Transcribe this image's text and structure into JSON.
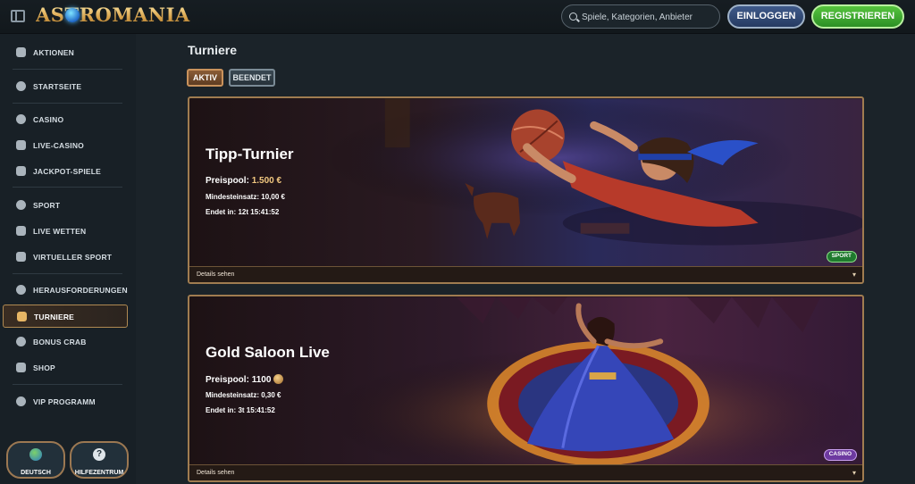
{
  "header": {
    "logo_text": "ASTROMANIA",
    "search_placeholder": "Spiele, Kategorien, Anbieter",
    "login_label": "EINLOGGEN",
    "register_label": "REGISTRIEREN"
  },
  "sidebar": {
    "items": [
      {
        "label": "AKTIONEN",
        "icon": "gift-icon"
      },
      {
        "label": "STARTSEITE",
        "icon": "globe-icon"
      },
      {
        "label": "CASINO",
        "icon": "casino-chip-icon"
      },
      {
        "label": "LIVE-CASINO",
        "icon": "cards-icon"
      },
      {
        "label": "JACKPOT-SPIELE",
        "icon": "clover-icon"
      },
      {
        "label": "SPORT",
        "icon": "soccer-ball-icon"
      },
      {
        "label": "LIVE WETTEN",
        "icon": "live-icon"
      },
      {
        "label": "VIRTUELLER SPORT",
        "icon": "monitor-icon"
      },
      {
        "label": "HERAUSFORDERUNGEN",
        "icon": "target-icon"
      },
      {
        "label": "TURNIERE",
        "icon": "trophy-icon"
      },
      {
        "label": "BONUS CRAB",
        "icon": "crab-icon"
      },
      {
        "label": "SHOP",
        "icon": "shop-icon"
      },
      {
        "label": "VIP PROGRAMM",
        "icon": "vip-gem-icon"
      }
    ],
    "language_label": "DEUTSCH",
    "help_label": "HILFEZENTRUM"
  },
  "main": {
    "title": "Turniere",
    "tabs": [
      {
        "label": "AKTIV",
        "active": true
      },
      {
        "label": "BEENDET",
        "active": false
      }
    ],
    "cards": [
      {
        "title": "Tipp-Turnier",
        "prize_label": "Preispool:",
        "prize_value": "1.500 €",
        "min_stake_label": "Mindesteinsatz:",
        "min_stake_value": "10,00 €",
        "ends_label": "Endet in:",
        "ends_value": "12t 15:41:52",
        "details_label": "Details sehen",
        "badge": "SPORT",
        "badge_color": "#1f7a2e"
      },
      {
        "title": "Gold Saloon Live",
        "prize_label": "Preispool:",
        "prize_value": "1100",
        "min_stake_label": "Mindesteinsatz:",
        "min_stake_value": "0,30 €",
        "ends_label": "Endet in:",
        "ends_value": "3t 15:41:52",
        "details_label": "Details sehen",
        "badge": "CASINO",
        "badge_color": "#6d3aa0"
      }
    ]
  },
  "colors": {
    "accent_gold": "#c49a62",
    "register_green": "#3fae33",
    "login_blue": "#2e4a78",
    "background": "#1b2329"
  }
}
